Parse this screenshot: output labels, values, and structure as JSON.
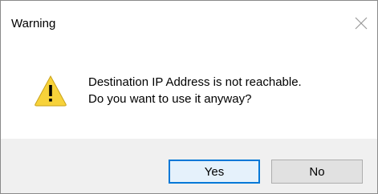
{
  "dialog": {
    "title": "Warning",
    "close_icon": "close-icon",
    "icon": "warning-triangle-icon",
    "message_line1": "Destination IP Address is not reachable.",
    "message_line2": "Do you want to use it anyway?",
    "buttons": {
      "yes_label": "Yes",
      "no_label": "No",
      "default": "Yes"
    }
  },
  "colors": {
    "warning_fill": "#f7d23a",
    "accent": "#0078d7",
    "footer_bg": "#f0f0f0"
  }
}
